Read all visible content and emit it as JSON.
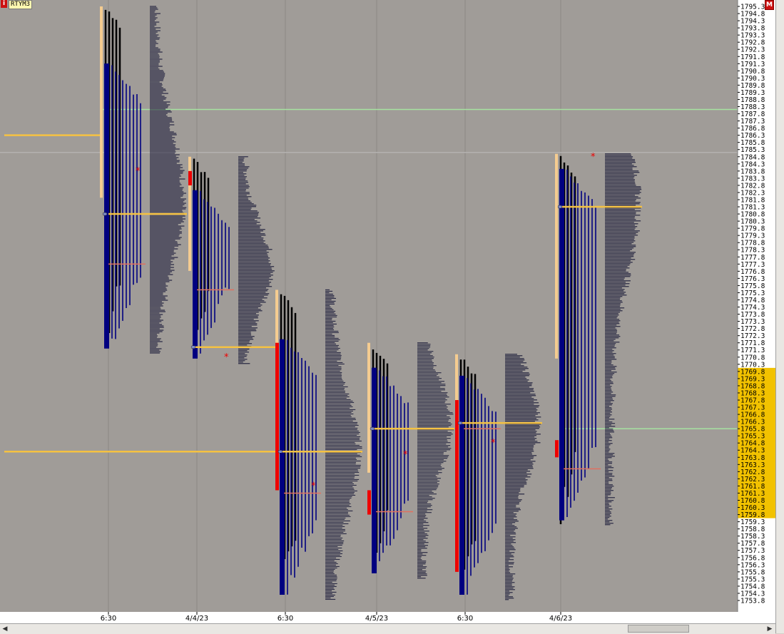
{
  "header": {
    "symbol": "RTYM3",
    "info_icon": "i",
    "mode_button": "M"
  },
  "colors": {
    "background": "#a09c98",
    "axis_bg": "#ffffff",
    "highlight_bg": "#f2c200",
    "tpo_blue": "#000080",
    "tpo_black": "#000000",
    "tpo_red": "#ee0000",
    "value_area": "#f5cc90",
    "poc_line": "#f5c242",
    "green_line": "#a6e3a1",
    "grey_line": "#b4b2b0",
    "median_line": "#e07060",
    "volume_profile": "#2a2a44"
  },
  "chart_data": {
    "type": "market_profile",
    "instrument": "RTYM3",
    "price_axis": {
      "max": 1795.3,
      "min": 1753.8,
      "tick": 0.5,
      "highlight_range": [
        1759.8,
        1769.8
      ],
      "tick_labels": [
        "1795.3",
        "1794.8",
        "1794.3",
        "1793.8",
        "1793.3",
        "1792.8",
        "1792.3",
        "1791.8",
        "1791.3",
        "1790.8",
        "1790.3",
        "1789.8",
        "1789.3",
        "1788.8",
        "1788.3",
        "1787.8",
        "1787.3",
        "1786.8",
        "1786.3",
        "1785.8",
        "1785.3",
        "1784.8",
        "1784.3",
        "1783.8",
        "1783.3",
        "1782.8",
        "1782.3",
        "1781.8",
        "1781.3",
        "1780.8",
        "1780.3",
        "1779.8",
        "1779.3",
        "1778.8",
        "1778.3",
        "1777.8",
        "1777.3",
        "1776.8",
        "1776.3",
        "1775.8",
        "1775.3",
        "1774.8",
        "1774.3",
        "1773.8",
        "1773.3",
        "1772.8",
        "1772.3",
        "1771.8",
        "1771.3",
        "1770.8",
        "1770.3",
        "1769.8",
        "1769.3",
        "1768.8",
        "1768.3",
        "1767.8",
        "1767.3",
        "1766.8",
        "1766.3",
        "1765.8",
        "1765.3",
        "1764.8",
        "1764.3",
        "1763.8",
        "1763.3",
        "1762.8",
        "1762.3",
        "1761.8",
        "1761.3",
        "1760.8",
        "1760.3",
        "1759.8",
        "1759.3",
        "1758.8",
        "1758.3",
        "1757.8",
        "1757.3",
        "1756.8",
        "1756.3",
        "1755.8",
        "1755.3",
        "1754.8",
        "1754.3",
        "1753.8"
      ]
    },
    "time_axis": [
      "6:30",
      "4/4/23",
      "6:30",
      "4/5/23",
      "6:30",
      "4/6/23"
    ],
    "reference_lines": [
      {
        "type": "green",
        "price": 1788.1
      },
      {
        "type": "grey",
        "price": 1785.1
      },
      {
        "type": "green",
        "price": 1765.8
      }
    ],
    "sessions": [
      {
        "label": "6:30",
        "high": 1795.3,
        "low": 1771.0,
        "poc": 1780.8,
        "val_low": 1788.3,
        "val_high": 1795.3,
        "median": 1777.3,
        "single_print": 1783.8,
        "peak": 1782.0,
        "poc_from_left": true
      },
      {
        "label": "4/4/23",
        "high": 1784.8,
        "low": 1770.3,
        "poc": 1771.5,
        "median": 1775.5,
        "single_print": 1770.8,
        "peak": 1777.0,
        "red_block": [
          1782.8,
          1783.8
        ]
      },
      {
        "label": "6:30",
        "high": 1775.5,
        "low": 1753.8,
        "poc": 1764.2,
        "median": 1761.3,
        "single_print": 1761.8,
        "peak": 1764.0,
        "red_block": [
          1761.5,
          1771.8
        ]
      },
      {
        "label": "4/5/23",
        "high": 1771.8,
        "low": 1755.3,
        "poc": 1765.8,
        "median": 1760.0,
        "single_print": 1764.0,
        "peak": 1766.0,
        "red_block": [
          1759.8,
          1761.5
        ]
      },
      {
        "label": "6:30",
        "high": 1771.0,
        "low": 1753.8,
        "poc": 1766.2,
        "median": 1765.8,
        "single_print": 1764.8,
        "peak": 1766.0,
        "red_block": [
          1755.8,
          1767.8
        ]
      },
      {
        "label": "4/6/23",
        "high": 1785.0,
        "low": 1759.0,
        "poc": 1781.3,
        "median": 1763.0,
        "single_print": 1784.8,
        "peak": 1781.5,
        "red_block": [
          1763.8,
          1765.0
        ]
      }
    ]
  }
}
